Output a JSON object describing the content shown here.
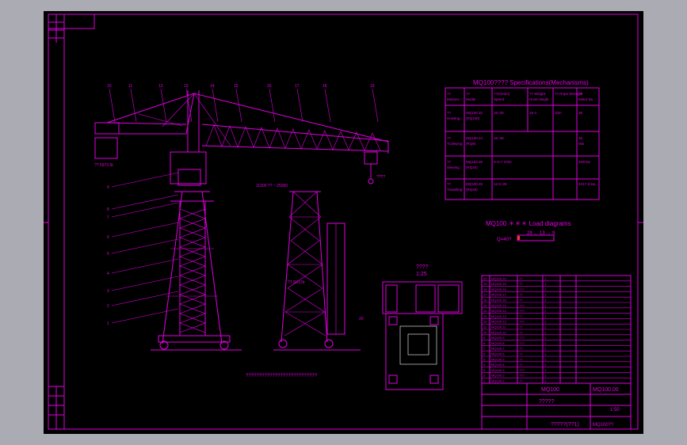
{
  "title_texts": {
    "spec_title": "MQ100???? Specifications(Mechanisms)",
    "load_title": "MQ100 ＊＊＊ Load diagrams",
    "view_label": "????",
    "view_scale": "1:25",
    "caption": "???????????????????????????"
  },
  "spec_table": {
    "headers": [
      "??\nMotions",
      "??\nModel",
      "??(m/min)\nSpeed",
      "?? Weight\nHoist Height",
      "?? Rope Strength",
      "??\nMotor kw"
    ],
    "rows": [
      {
        "motion": "??\nHoisting",
        "model": "MQ100.32\n(RQ100)",
        "speed": "16~25",
        "weight": "15-4",
        "height": "10m",
        "motor": "36"
      },
      {
        "motion": "??\nTrolleying",
        "model": "MQ100.24\n(RQ8)",
        "speed": "16~38",
        "weight": "",
        "height": "",
        "motor": "35\nMin"
      },
      {
        "motion": "??\nSlewing",
        "model": "MQ100.25\n(RQ40)",
        "speed": "0~0.7 r/min",
        "weight": "",
        "height": "",
        "motor": "2X8 kw"
      },
      {
        "motion": "??\nTravelling",
        "model": "MQ100.25\n(RQ40)",
        "speed": "12.5~25",
        "weight": "",
        "height": "",
        "motor": "4X17.5 kw"
      }
    ]
  },
  "load_diagram": {
    "row1": "29 ← 13 → 9",
    "row2": "Q=40?"
  },
  "callouts": [
    "10",
    "11",
    "12",
    "13",
    "14",
    "15",
    "16",
    "17",
    "18",
    "19",
    "9",
    "8",
    "7",
    "6",
    "5",
    "4",
    "3",
    "2",
    "1",
    "20"
  ],
  "dimensions": {
    "span_a": "?? 5973.5t",
    "jib_radius": "11000 ?? ~ 25000",
    "height": "??",
    "rail_gauge": "?? 9X3.5t",
    "hook": "????"
  },
  "parts_table": {
    "rows": [
      [
        "20",
        "MQ100.20",
        "??",
        "1"
      ],
      [
        "19",
        "MQ100.19",
        "??",
        "1"
      ],
      [
        "18",
        "MQ100.18",
        "???",
        "1"
      ],
      [
        "17",
        "MQ100.17",
        "??",
        "1"
      ],
      [
        "16",
        "MQ100.16",
        "??",
        "1"
      ],
      [
        "15",
        "MQ100.15",
        "???",
        "1"
      ],
      [
        "14",
        "MQ100.14",
        "???",
        "1"
      ],
      [
        "13",
        "MQ100.13",
        "??",
        "1"
      ],
      [
        "12",
        "MQ100.12",
        "???",
        "1"
      ],
      [
        "11",
        "MQ100.11",
        "??",
        "1"
      ],
      [
        "10",
        "MQ100.10",
        "??",
        "1"
      ],
      [
        "9",
        "MQ100.9",
        "???",
        "1"
      ],
      [
        "8",
        "MQ100.8",
        "???",
        "1"
      ],
      [
        "7",
        "MQ100.7",
        "??",
        "1"
      ],
      [
        "6",
        "MQ100.6",
        "??",
        "1"
      ],
      [
        "5",
        "MQ100.5",
        "??",
        "1"
      ],
      [
        "4",
        "MQ100.4",
        "??",
        "1"
      ],
      [
        "3",
        "MQ100.3",
        "???",
        "1"
      ],
      [
        "2",
        "MQ100.2",
        "???",
        "1"
      ],
      [
        "1",
        "MQ100.1",
        "??",
        "1"
      ]
    ]
  },
  "title_block": {
    "drawing_no": "MQ100",
    "drawing_code": "MQ100.00",
    "name": "?????",
    "scale_note": "1:50",
    "sheet_label": "?????(??1)",
    "part": "MQ100??"
  },
  "colors": {
    "line": "#e000e0",
    "detail": "#ffffff",
    "background": "#000000",
    "page": "#ababb3"
  }
}
